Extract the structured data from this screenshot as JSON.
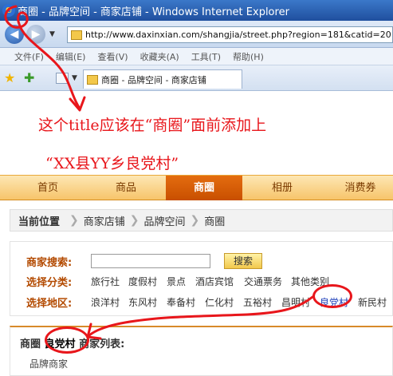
{
  "window": {
    "title": "商圈 - 品牌空间 - 商家店铺 - Windows Internet Explorer"
  },
  "address_bar": {
    "url": "http://www.daxinxian.com/shangjia/street.php?region=181&catid=20"
  },
  "menu": [
    "文件(F)",
    "编辑(E)",
    "查看(V)",
    "收藏夹(A)",
    "工具(T)",
    "帮助(H)"
  ],
  "tab": {
    "label": "商圈 - 品牌空间 - 商家店铺"
  },
  "annotation": {
    "line1": "这个title应该在“商圈”面前添加上",
    "line2": "“XX县YY乡良党村”"
  },
  "main_nav": {
    "items": [
      "首页",
      "商品",
      "商圈",
      "相册",
      "消费券"
    ],
    "active": "商圈"
  },
  "breadcrumb": {
    "label": "当前位置",
    "items": [
      "商家店铺",
      "品牌空间",
      "商圈"
    ]
  },
  "filter": {
    "search_label": "商家搜索:",
    "search_button": "搜索",
    "category_label": "选择分类:",
    "categories": [
      "旅行社",
      "度假村",
      "景点",
      "酒店宾馆",
      "交通票务",
      "其他类别"
    ],
    "region_label": "选择地区:",
    "regions": [
      "浪洋村",
      "东风村",
      "奉备村",
      "仁化村",
      "五裕村",
      "昌明村",
      "良党村",
      "新民村"
    ],
    "selected_region": "良党村"
  },
  "list": {
    "prefix": "商圈",
    "region": "良党村",
    "suffix": "商家列表:",
    "sub": "品牌商家"
  },
  "colors": {
    "annotation": "#e8161b",
    "nav_active": "#d85c06",
    "label": "#b34a00"
  }
}
